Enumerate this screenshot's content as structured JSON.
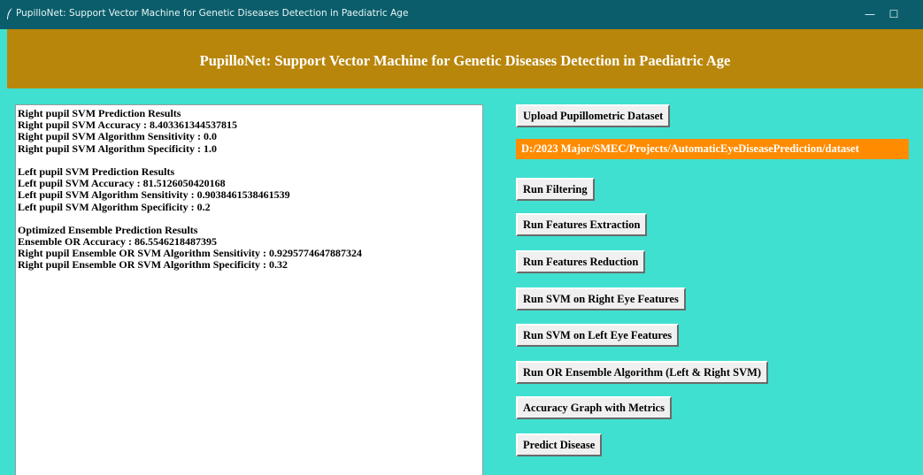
{
  "window": {
    "title": "PupilloNet: Support Vector Machine for Genetic Diseases Detection in Paediatric Age",
    "minimize": "—",
    "maximize": "☐",
    "close": "✕"
  },
  "header": {
    "title": "PupilloNet: Support Vector Machine for Genetic Diseases Detection in Paediatric Age",
    "background": "#b8860b"
  },
  "output": {
    "lines": [
      "Right pupil SVM Prediction Results",
      "Right pupil SVM Accuracy : 8.403361344537815",
      "Right pupil SVM Algorithm Sensitivity : 0.0",
      "Right pupil SVM Algorithm Specificity : 1.0",
      "",
      "Left pupil SVM Prediction Results",
      "Left pupil SVM Accuracy : 81.5126050420168",
      "Left pupil SVM Algorithm Sensitivity : 0.9038461538461539",
      "Left pupil SVM Algorithm Specificity : 0.2",
      "",
      "Optimized Ensemble Prediction Results",
      "Ensemble OR Accuracy : 86.5546218487395",
      "Right pupil Ensemble OR SVM Algorithm Sensitivity : 0.9295774647887324",
      "Right pupil Ensemble OR SVM Algorithm Specificity : 0.32"
    ]
  },
  "controls": {
    "upload_label": "Upload Pupillometric Dataset",
    "dataset_path": "D:/2023 Major/SMEC/Projects/AutomaticEyeDiseasePrediction/dataset",
    "filtering_label": "Run Filtering",
    "extraction_label": "Run Features Extraction",
    "reduction_label": "Run Features Reduction",
    "svm_right_label": "Run SVM on Right Eye Features",
    "svm_left_label": "Run SVM on Left Eye Features",
    "ensemble_label": "Run OR Ensemble Algorithm (Left & Right SVM)",
    "graph_label": "Accuracy Graph with Metrics",
    "predict_label": "Predict Disease"
  },
  "colors": {
    "background": "#40e0d0",
    "titlebar": "#0b5d6b",
    "path_label": "#ff8c00"
  }
}
